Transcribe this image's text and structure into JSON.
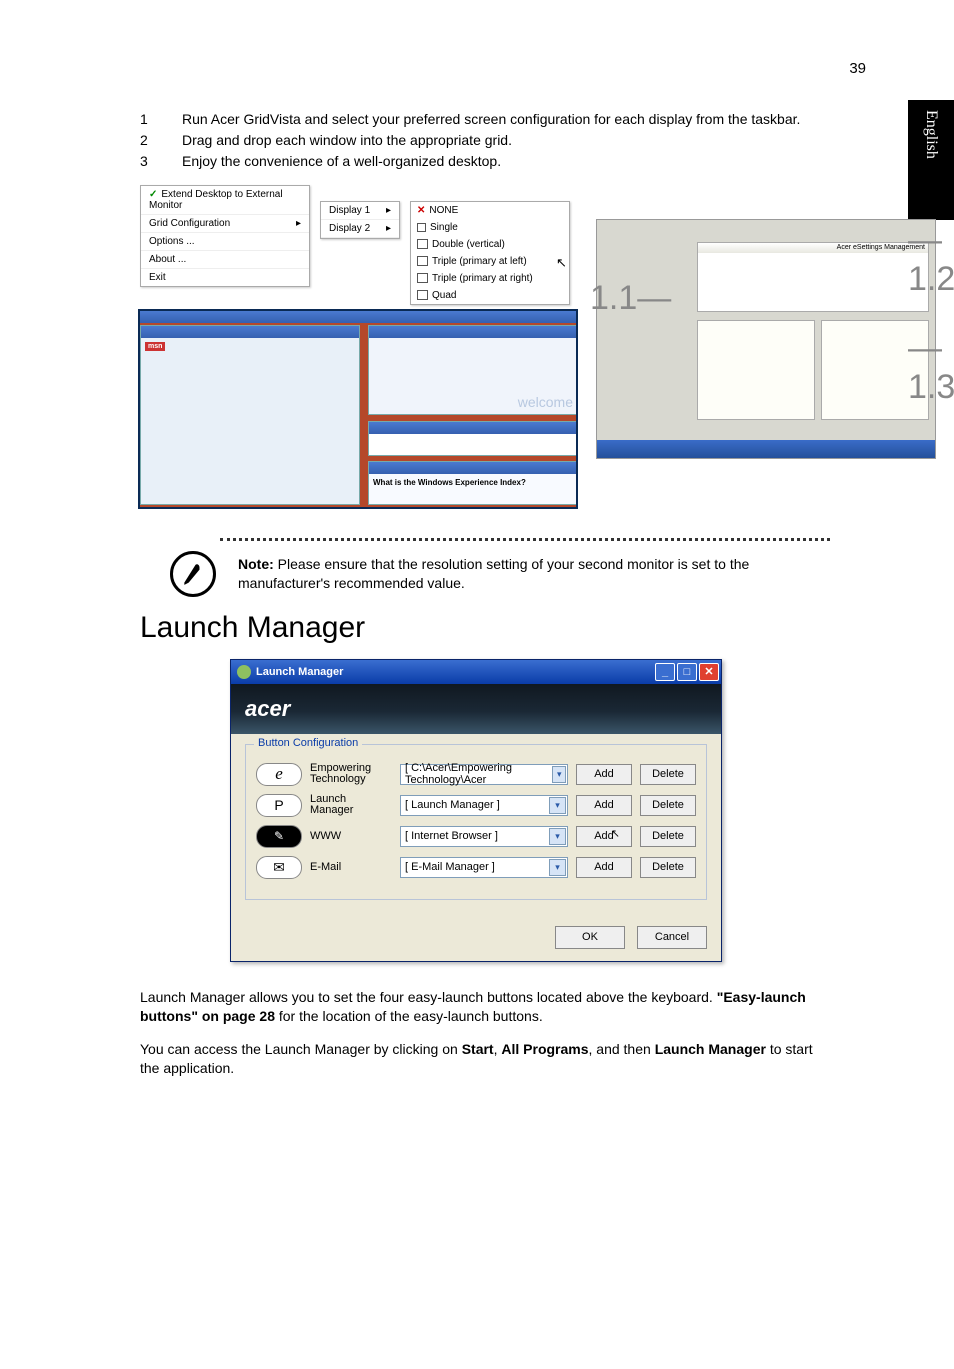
{
  "page_number": "39",
  "language_tab": "English",
  "steps": [
    {
      "n": "1",
      "t": "Run Acer GridVista and select your preferred screen configuration for each display from the taskbar."
    },
    {
      "n": "2",
      "t": "Drag and drop each window into the appropriate grid."
    },
    {
      "n": "3",
      "t": "Enjoy the convenience of a well-organized desktop."
    }
  ],
  "context_menu": {
    "extend": "Extend Desktop to External Monitor",
    "grid": "Grid Configuration",
    "options": "Options ...",
    "about": "About ...",
    "exit": "Exit"
  },
  "display_submenu": {
    "d1": "Display 1",
    "d2": "Display 2"
  },
  "layout_submenu": {
    "none": "NONE",
    "single": "Single",
    "double": "Double (vertical)",
    "triple_left": "Triple (primary at left)",
    "triple_right": "Triple (primary at right)",
    "quad": "Quad"
  },
  "messy": {
    "msn": "msn",
    "welcome": "welcome",
    "wei": "What is the Windows Experience Index?"
  },
  "tri": {
    "acer_emgmt": "Acer eSettings Management"
  },
  "callouts": {
    "c11": "1.1",
    "c12": "1.2",
    "c13": "1.3"
  },
  "note": {
    "label": "Note:",
    "text": " Please ensure that the resolution setting of your second monitor is set to the manufacturer's recommended value."
  },
  "heading": "Launch Manager",
  "lm": {
    "title": "Launch Manager",
    "brand": "acer",
    "group": "Button Configuration",
    "rows": [
      {
        "key": "e",
        "klass": "e-italic",
        "label": "Empowering Technology",
        "value": "[  C:\\Acer\\Empowering Technology\\Acer",
        "dd": false
      },
      {
        "key": "P",
        "klass": "kp",
        "label": "Launch Manager",
        "value": "[  Launch Manager  ]",
        "dd": true
      },
      {
        "key": "✎",
        "klass": "kwww",
        "label": "WWW",
        "value": "[  Internet Browser  ]",
        "dd": true
      },
      {
        "key": "✉",
        "klass": "kenv",
        "label": "E-Mail",
        "value": "[  E-Mail Manager  ]",
        "dd": true
      }
    ],
    "add": "Add",
    "del": "Delete",
    "ok": "OK",
    "cancel": "Cancel"
  },
  "para1_a": "Launch Manager allows you to set the four easy-launch buttons located above the keyboard. ",
  "para1_b": "\"Easy-launch buttons\" on page 28",
  "para1_c": " for the location of the easy-launch buttons.",
  "para2_a": "You can access the Launch Manager by clicking on ",
  "para2_b": "Start",
  "para2_c": ", ",
  "para2_d": "All Programs",
  "para2_e": ", and then ",
  "para2_f": "Launch Manager",
  "para2_g": " to start the application."
}
